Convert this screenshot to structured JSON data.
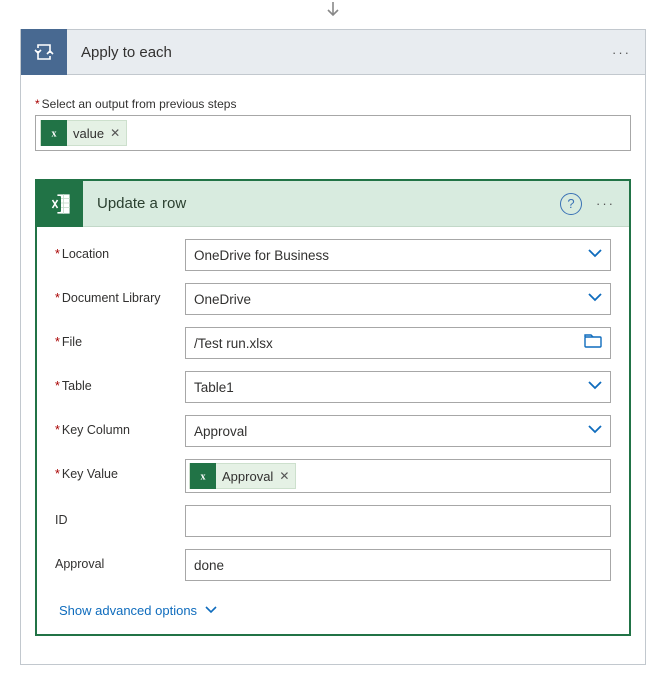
{
  "arrow": "↓",
  "loop": {
    "title": "Apply to each",
    "menu": "···",
    "outputLabel": "Select an output from previous steps",
    "outputToken": {
      "text": "value",
      "x": "✕"
    }
  },
  "action": {
    "title": "Update a row",
    "help": "?",
    "menu": "···",
    "fields": {
      "location": {
        "label": "Location",
        "value": "OneDrive for Business"
      },
      "library": {
        "label": "Document Library",
        "value": "OneDrive"
      },
      "file": {
        "label": "File",
        "value": "/Test run.xlsx"
      },
      "table": {
        "label": "Table",
        "value": "Table1"
      },
      "keycol": {
        "label": "Key Column",
        "value": "Approval"
      },
      "keyval": {
        "label": "Key Value",
        "token": {
          "text": "Approval",
          "x": "✕"
        }
      },
      "id": {
        "label": "ID",
        "value": ""
      },
      "approval": {
        "label": "Approval",
        "value": "done"
      }
    },
    "advanced": "Show advanced options"
  },
  "icons": {
    "excel": "x",
    "loop": "⟳",
    "chevron": "⌄",
    "folder": "▭"
  }
}
